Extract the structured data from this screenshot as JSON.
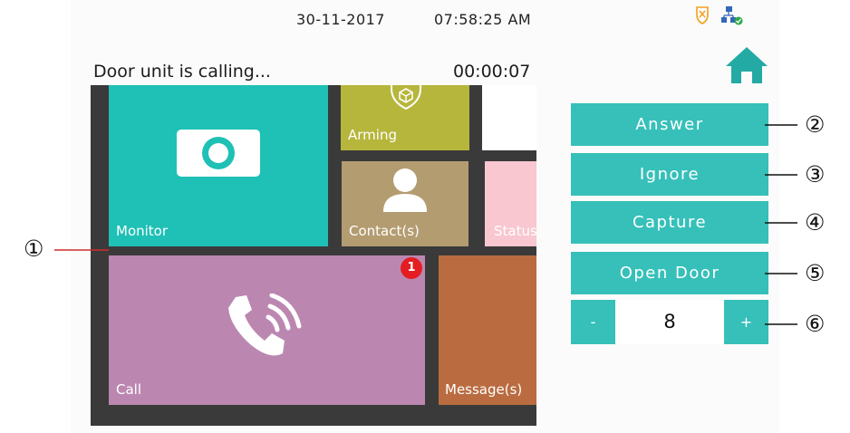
{
  "status_bar": {
    "date": "30-11-2017",
    "time": "07:58:25 AM",
    "icons": [
      "shield-alert-icon",
      "network-connected-icon"
    ]
  },
  "call": {
    "status_text": "Door unit is calling...",
    "timer": "00:00:07"
  },
  "home_icon": "home-icon",
  "tiles": {
    "monitor": "Monitor",
    "arming": "Arming",
    "contact": "Contact(s)",
    "status": "Status",
    "call": "Call",
    "call_badge": "1",
    "message": "Message(s)"
  },
  "actions": {
    "answer": "Answer",
    "ignore": "Ignore",
    "capture": "Capture",
    "open_door": "Open Door"
  },
  "stepper": {
    "minus": "-",
    "value": "8",
    "plus": "+"
  },
  "callouts": [
    "①",
    "②",
    "③",
    "④",
    "⑤",
    "⑥"
  ],
  "colors": {
    "accent": "#36c0b9",
    "monitor": "#1fc0b5",
    "arming": "#b6b63c",
    "contact": "#b49c71",
    "status": "#f8c7cf",
    "call": "#bb87b0",
    "message": "#ba6c40",
    "badge": "#e41d22",
    "home": "#23aaa4"
  }
}
